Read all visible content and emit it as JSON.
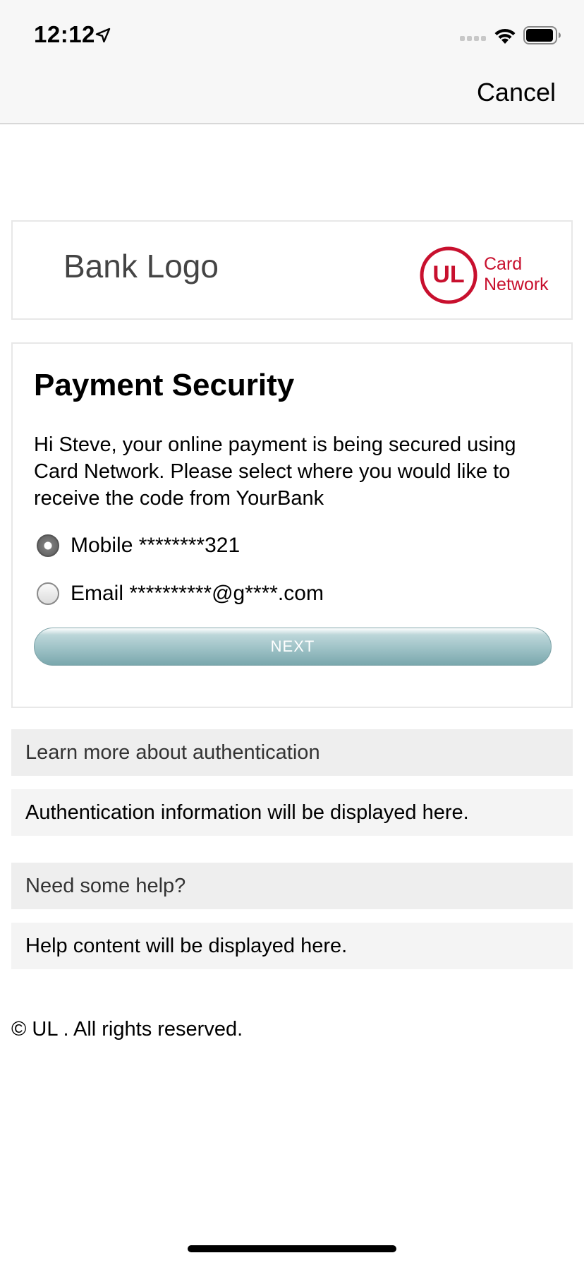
{
  "status_bar": {
    "time": "12:12"
  },
  "nav": {
    "cancel_label": "Cancel"
  },
  "header": {
    "bank_logo_text": "Bank Logo",
    "network_logo_mark": "UL",
    "network_logo_line1": "Card",
    "network_logo_line2": "Network"
  },
  "card": {
    "title": "Payment Security",
    "description": "Hi Steve, your online payment is being secured using Card Network. Please select where you would like to receive the code from YourBank",
    "options": [
      {
        "label": "Mobile ********321",
        "selected": true
      },
      {
        "label": "Email **********@g****.com",
        "selected": false
      }
    ],
    "next_label": "NEXT"
  },
  "panels": {
    "learn_more_header": "Learn more about authentication",
    "learn_more_body": "Authentication information will be displayed here.",
    "help_header": "Need some help?",
    "help_body": "Help content will be displayed here."
  },
  "footer": {
    "copyright": "© UL . All rights reserved."
  },
  "colors": {
    "brand_red": "#c8102e",
    "button_teal": "#9ec2c6",
    "panel_header_bg": "#eeeeee",
    "panel_body_bg": "#f4f4f4"
  }
}
